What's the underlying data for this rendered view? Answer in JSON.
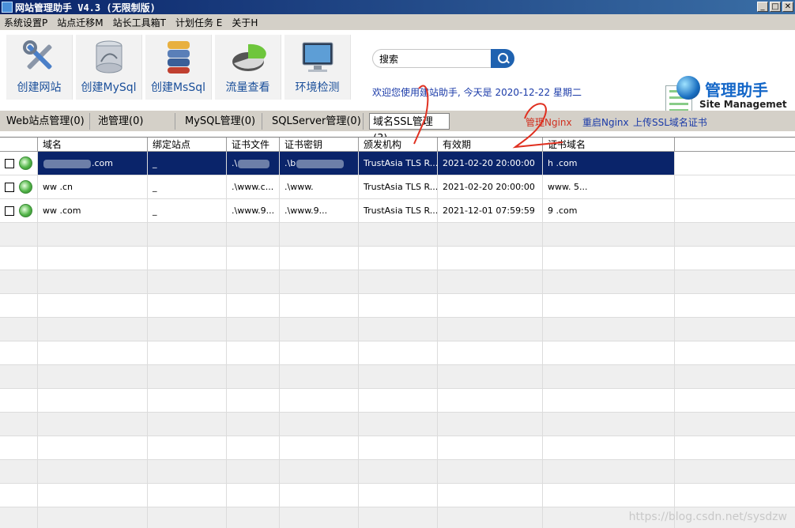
{
  "window": {
    "title": "网站管理助手 V4.3 (无限制版)"
  },
  "menu": [
    "系统设置P",
    "站点迁移M",
    "站长工具箱T",
    "计划任务 E",
    "关于H"
  ],
  "toolbar": [
    {
      "label": "创建网站",
      "icon": "wrench-screwdriver-icon"
    },
    {
      "label": "创建MySql",
      "icon": "mysql-database-icon"
    },
    {
      "label": "创建MsSql",
      "icon": "mssql-database-icon"
    },
    {
      "label": "流量查看",
      "icon": "pie-chart-icon"
    },
    {
      "label": "环境检测",
      "icon": "monitor-icon"
    }
  ],
  "search": {
    "value": "搜索"
  },
  "welcome": "欢迎您使用建站助手, 今天是 2020-12-22 星期二",
  "logo": {
    "title": "管理助手",
    "subtitle": "Site Managemet"
  },
  "tabs": [
    "Web站点管理(0)",
    "池管理(0)",
    "MySQL管理(0)",
    "SQLServer管理(0)",
    "域名SSL管理(3)"
  ],
  "tab_actions": [
    "管理Nginx",
    "重启Nginx",
    "上传SSL域名证书"
  ],
  "columns": [
    "域名",
    "绑定站点",
    "证书文件",
    "证书密钥",
    "颁发机构",
    "有效期",
    "证书域名"
  ],
  "rows": [
    {
      "domain": ".com",
      "site": "_",
      "cert_file": ".\\",
      "cert_key": ".\\b",
      "issuer": "TrustAsia TLS R...",
      "expires": "2021-02-20 20:00:00",
      "cert_domain": "h .com"
    },
    {
      "domain": "ww .cn",
      "site": "_",
      "cert_file": ".\\www.c...",
      "cert_key": ".\\www.",
      "issuer": "TrustAsia TLS R...",
      "expires": "2021-02-20 20:00:00",
      "cert_domain": "www. 5..."
    },
    {
      "domain": "ww .com",
      "site": "_",
      "cert_file": ".\\www.9...",
      "cert_key": ".\\www.9...",
      "issuer": "TrustAsia TLS R...",
      "expires": "2021-12-01 07:59:59",
      "cert_domain": "9 .com"
    }
  ],
  "watermark": "https://blog.csdn.net/sysdzw",
  "annotations": [
    "1",
    "2"
  ]
}
